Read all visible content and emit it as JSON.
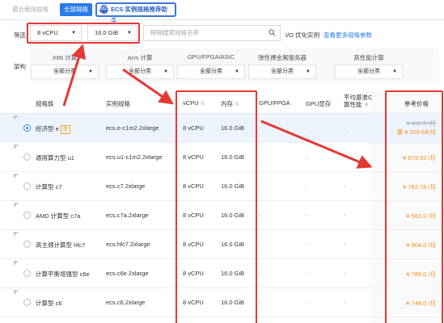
{
  "tabs": {
    "recent": "最近使用规格",
    "all": "全部规格",
    "ecs_helper": "ECS 实例规格推荐助手",
    "ecs_icon_text": "ECS"
  },
  "filter": {
    "label": "筛选",
    "vcpu": "8 vCPU",
    "memory": "16.0 GiB",
    "search_placeholder": "模糊搜索规格名称",
    "io_optimized": "I/O 优化实例",
    "more_params": "查看更多规格参数"
  },
  "arch": {
    "label": "架构",
    "columns": [
      {
        "title": "X86 计算",
        "value": "全部分类"
      },
      {
        "title": "Arm 计算",
        "value": "全部分类"
      },
      {
        "title": "GPU/FPGA/ASIC",
        "value": "全部分类"
      },
      {
        "title": "弹性裸金属服务器",
        "value": "全部分类"
      },
      {
        "title": "高性能计算",
        "value": "全部分类"
      }
    ]
  },
  "table": {
    "headers": {
      "family": "规格族",
      "spec": "实例规格",
      "vcpu": "vCPU",
      "memory": "内存",
      "gpu_fpga": "GPU/FPGA",
      "gpu_mem": "GPU显存",
      "baseline_1": "平均基准C",
      "baseline_2": "算性能",
      "price": "参考价格"
    },
    "rows": [
      {
        "family": "经济型 e",
        "badge": "荐",
        "spec": "ecs.e-c1m2.2xlarge",
        "vcpu": "8 vCPU",
        "memory": "16.0 GiB",
        "gpu": "-",
        "gpu_mem": "-",
        "baseline": "-",
        "price_old": "¥ 432.0 /月",
        "price": "惠 ¥ 319.68/月",
        "selected": true
      },
      {
        "family": "通用算力型 u1",
        "spec": "ecs.u1-c1m2.2xlarge",
        "vcpu": "8 vCPU",
        "memory": "16.0 GiB",
        "gpu": "-",
        "gpu_mem": "-",
        "baseline": "-",
        "price": "¥ 673.92 /月"
      },
      {
        "family": "计算型 c7",
        "spec": "ecs.c7.2xlarge",
        "vcpu": "8 vCPU",
        "memory": "16.0 GiB",
        "gpu": "-",
        "gpu_mem": "-",
        "baseline": "-",
        "price": "¥ 782.78 /月"
      },
      {
        "family": "AMD 计算型 c7a",
        "spec": "ecs.c7a.2xlarge",
        "vcpu": "8 vCPU",
        "memory": "16.0 GiB",
        "gpu": "-",
        "gpu_mem": "-",
        "baseline": "-",
        "price": "¥ 563.2 /月"
      },
      {
        "family": "高主频计算型 hfc7",
        "spec": "ecs.hfc7.2xlarge",
        "vcpu": "8 vCPU",
        "memory": "16.0 GiB",
        "gpu": "-",
        "gpu_mem": "-",
        "baseline": "-",
        "price": "¥ 904.0 /月"
      },
      {
        "family": "计算平衡增强型 c6e",
        "spec": "ecs.c6e.2xlarge",
        "vcpu": "8 vCPU",
        "memory": "16.0 GiB",
        "gpu": "-",
        "gpu_mem": "-",
        "baseline": "-",
        "price": "¥ 788.0 /月"
      },
      {
        "family": "计算型 c6",
        "spec": "ecs.c6.2xlarge",
        "vcpu": "8 vCPU",
        "memory": "16.0 GiB",
        "gpu": "-",
        "gpu_mem": "-",
        "baseline": "-",
        "price": "¥ 748.0 /月"
      }
    ]
  },
  "colors": {
    "accent": "#2a7bea",
    "highlight_red": "#e53935",
    "price_orange": "#f5901b"
  }
}
